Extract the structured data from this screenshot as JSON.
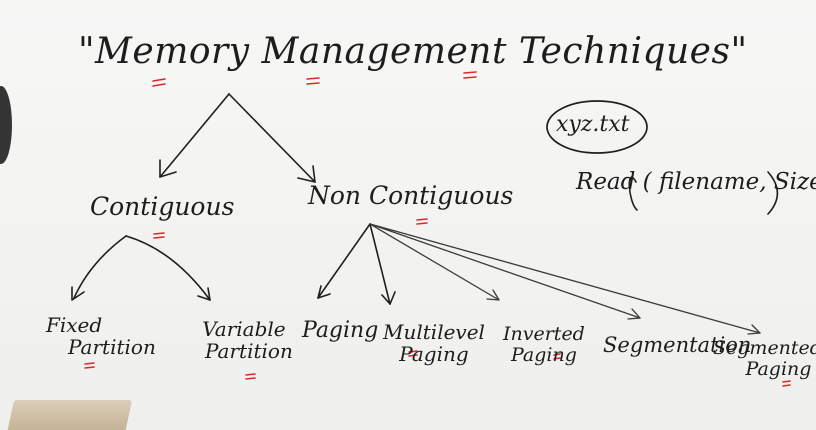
{
  "diagram": {
    "title": "\"Memory Management Techniques\"",
    "branches": {
      "contiguous": "Contiguous",
      "non_contiguous": "Non Contiguous"
    },
    "contiguous_children": [
      [
        "Fixed",
        "Partition"
      ],
      [
        "Variable",
        "Partition"
      ]
    ],
    "non_contiguous_children": [
      [
        "Paging"
      ],
      [
        "Multilevel",
        "Paging"
      ],
      [
        "Inverted",
        "Paging"
      ],
      [
        "Segmentation"
      ],
      [
        "Segmented",
        "Paging"
      ]
    ]
  },
  "side_note": {
    "file": "xyz.txt",
    "call": "Read ( filename, Size)"
  },
  "colors": {
    "ink": "#1f1f1f",
    "underline": "#d92a2a",
    "board": "#f4f4f2"
  }
}
